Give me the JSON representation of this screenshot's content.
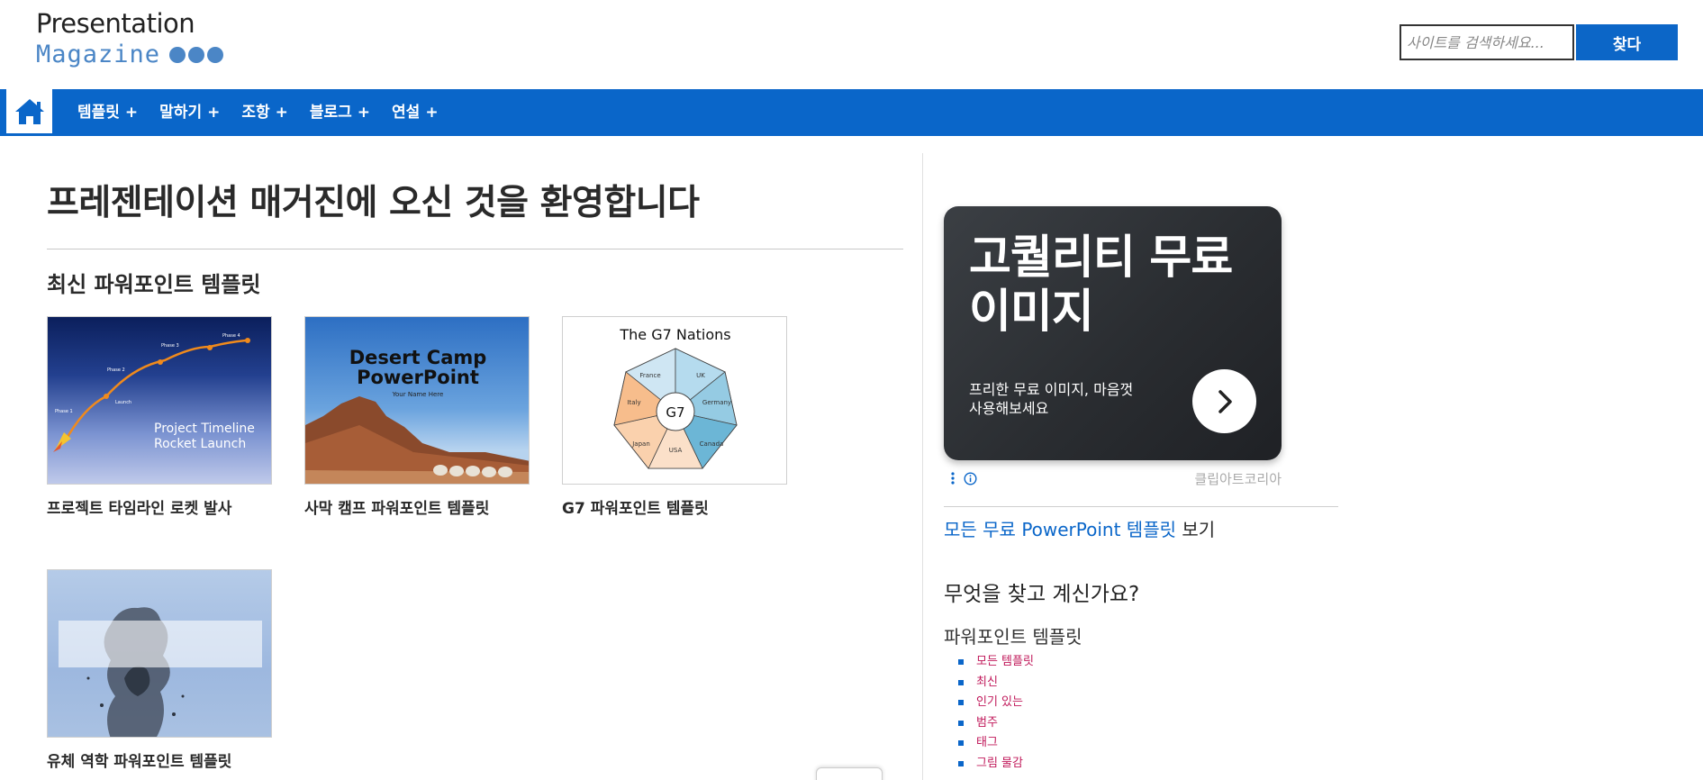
{
  "logo": {
    "line1": "Presentation",
    "line2": "Magazine",
    "dot_color": "#4b86c6"
  },
  "search": {
    "placeholder": "사이트를 검색하세요...",
    "button_label": "찾다"
  },
  "nav": {
    "home_icon": "home-icon",
    "items": [
      {
        "label": "템플릿",
        "plus": "+"
      },
      {
        "label": "말하기",
        "plus": "+"
      },
      {
        "label": "조항",
        "plus": "+"
      },
      {
        "label": "블로그",
        "plus": "+"
      },
      {
        "label": "연설",
        "plus": "+"
      }
    ],
    "bar_color": "#0a66c9"
  },
  "main": {
    "title": "프레젠테이션 매거진에 오신 것을 환영합니다",
    "section_title": "최신 파워포인트 템플릿",
    "cards": [
      {
        "title": "프로젝트 타임라인 로켓 발사",
        "thumb_text": [
          "Project Timeline",
          "Rocket Launch"
        ],
        "phases": [
          "Phase 1",
          "Launch",
          "Phase 2",
          "Phase 3",
          "Phase 4"
        ]
      },
      {
        "title": "사막 캠프 파워포인트 템플릿",
        "thumb_text": [
          "Desert Camp",
          "PowerPoint"
        ],
        "thumb_sub": "Your Name Here"
      },
      {
        "title": "G7 파워포인트 템플릿",
        "thumb_title": "The G7 Nations",
        "center": "G7",
        "countries": [
          "France",
          "UK",
          "Germany",
          "Canada",
          "USA",
          "Japan",
          "Italy"
        ]
      },
      {
        "title": "유체 역학 파워포인트 템플릿"
      }
    ]
  },
  "sidebar": {
    "ad": {
      "headline": "고퀄리티 무료 이미지",
      "subtext": "프리한 무료 이미지, 마음껏 사용해보세요",
      "brand": "클립아트코리아"
    },
    "free_link": {
      "link_text": "모든 무료 PowerPoint 템플릿",
      "rest_text": " 보기"
    },
    "looking_title": "무엇을 찾고 계신가요?",
    "category_title": "파워포인트 템플릿",
    "categories": [
      "모든 템플릿",
      "최신",
      "인기 있는",
      "범주",
      "태그",
      "그림 물감"
    ]
  }
}
